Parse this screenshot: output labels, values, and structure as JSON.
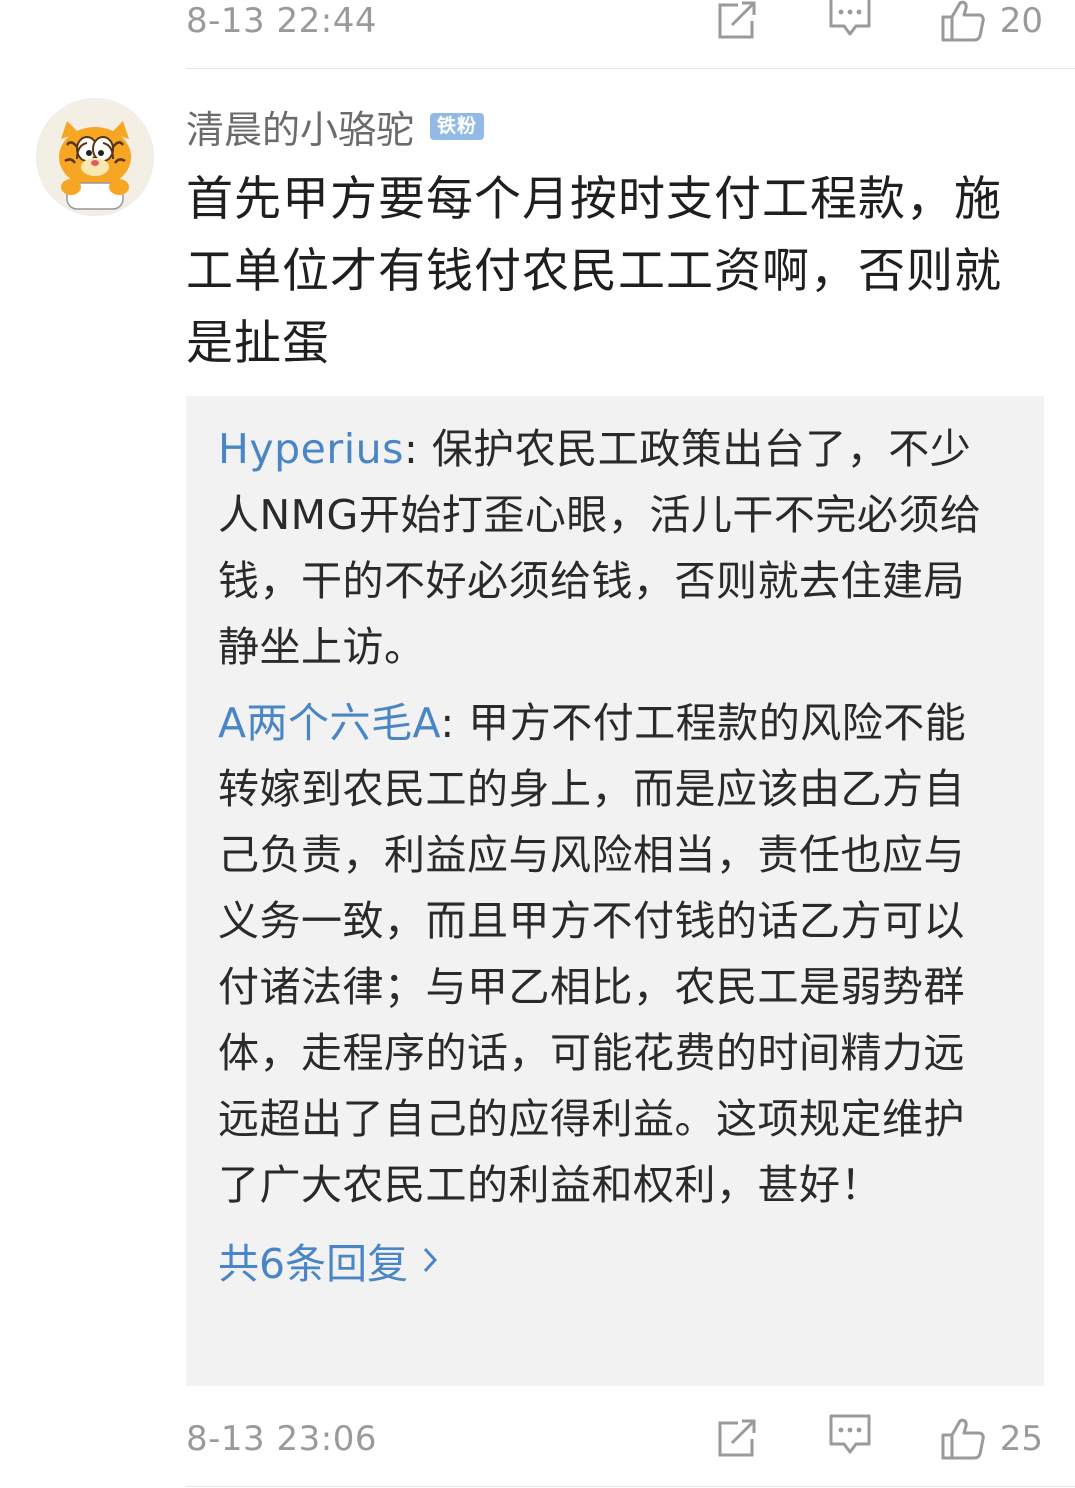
{
  "top_bar": {
    "time": "8-13 22:44",
    "like_count": "20",
    "icons": [
      "share-icon",
      "reply-icon",
      "like-icon"
    ]
  },
  "comment": {
    "username": "清晨的小骆驼",
    "badge": "铁粉",
    "text": "首先甲方要每个月按时支付工程款，施工单位才有钱付农民工工资啊，否则就是扯蛋",
    "avatar": "garfield-avatar",
    "replies": [
      {
        "author": "Hyperius",
        "sep": ": ",
        "text": "保护农民工政策出台了，不少人NMG开始打歪心眼，活儿干不完必须给钱，干的不好必须给钱，否则就去住建局静坐上访。"
      },
      {
        "author": "A两个六毛A",
        "sep": ": ",
        "text": "甲方不付工程款的风险不能转嫁到农民工的身上，而是应该由乙方自己负责，利益应与风险相当，责任也应与义务一致，而且甲方不付钱的话乙方可以付诸法律；与甲乙相比，农民工是弱势群体，走程序的话，可能花费的时间精力远远超出了自己的应得利益。这项规定维护了广大农民工的利益和权利，甚好！"
      }
    ],
    "more_replies": "共6条回复",
    "time": "8-13 23:06",
    "like_count": "25"
  },
  "colors": {
    "link_blue": "#4a86c5",
    "badge_blue": "#93b9e6",
    "muted_gray": "#9a9a9a",
    "reply_bg": "#f2f2f2"
  }
}
